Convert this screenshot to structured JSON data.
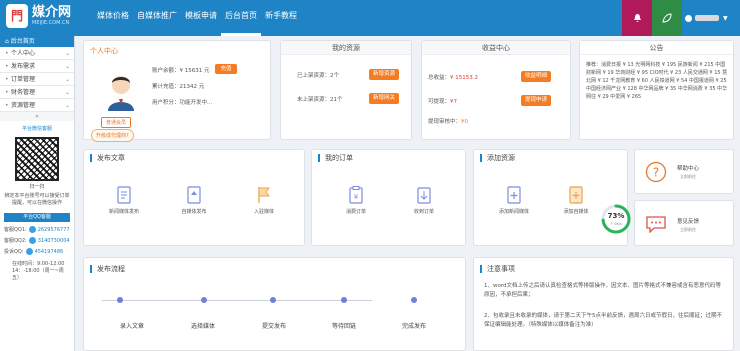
{
  "topbar": {
    "logo_mark": "門",
    "logo_title": "媒介网",
    "logo_sub": "MEIJIE.COM.CN",
    "nav": [
      "媒体价格",
      "自媒体推广",
      "模板申请",
      "后台首页",
      "新手教程"
    ],
    "active_nav": 3,
    "colors": {
      "bar": "#1e84c6",
      "bell": "#b0195a",
      "home": "#2f8c44"
    }
  },
  "sidebar": {
    "header": "后台首页",
    "items": [
      {
        "label": "个人中心",
        "icon": "user-icon"
      },
      {
        "label": "发布需求",
        "icon": "send-icon"
      },
      {
        "label": "订单管理",
        "icon": "order-icon"
      },
      {
        "label": "财务管理",
        "icon": "finance-icon"
      },
      {
        "label": "资源管理",
        "icon": "resource-icon"
      }
    ],
    "wechat_title": "平台微信客服",
    "qr_caption": "扫一扫",
    "qr_desc": "绑定本平台账号可以接受订单提醒，可以在微信操作",
    "qq_title": "平台QQ客服",
    "qq": [
      {
        "label": "客服QQ1:",
        "number": "2629576777"
      },
      {
        "label": "客服QQ2:",
        "number": "3140730004"
      },
      {
        "label": "投诉QQ:",
        "number": "454197486"
      }
    ],
    "hours_1": "在线时间：9:00-12:00",
    "hours_2": "14：-18:00（周一~周五）"
  },
  "personal": {
    "title": "个人中心",
    "login_tag": "普通会员",
    "upgrade": "升级成代理商?",
    "balance_label": "账户余额：",
    "balance_value": "¥ 15631 元",
    "recharge": "充值",
    "spent_label": "累计充值：",
    "spent_value": "21342 元",
    "points_label": "用户积分：",
    "points_value": "功能开发中..."
  },
  "resources": {
    "title": "我的资源",
    "online_label": "已上架资源：",
    "online_count": "2个",
    "offline_label": "未上架资源：",
    "offline_count": "21个",
    "btn_new": "新增资源",
    "btn_all": "新增网关"
  },
  "income": {
    "title": "收益中心",
    "total_label": "总收益：",
    "total_value": "¥ 15153.2",
    "withdrawable_label": "可提现：",
    "withdrawable_value": "¥7",
    "pending_label": "提现审核中：",
    "pending_value": "¥0",
    "btn_detail": "收益明细",
    "btn_withdraw": "提现申请"
  },
  "notice": {
    "title": "公告",
    "text": "推荐：消费日报 ¥ 13 光明网科技 ¥ 195 民族新闻 ¥ 215 中国财新网 ¥ 19 华商财经 ¥ 95 CIO时代 ¥ 23 人民交通网 ¥ 15 慧北网 ¥ 12 千龙网教育 ¥ 60 人民铁道网 ¥ 54 中国报道网 ¥ 25 中国经济网产业 ¥ 128 中华网品牌 ¥ 35 中华网消费 ¥ 35 中华网往 ¥ 29 中爱网 ¥ 265"
  },
  "publish": {
    "title": "发布文章",
    "tools": [
      {
        "label": "新闻媒体发布",
        "icon": "news-media-icon"
      },
      {
        "label": "自媒体发布",
        "icon": "self-media-icon"
      },
      {
        "label": "入驻媒体",
        "icon": "flag-icon"
      }
    ]
  },
  "orders": {
    "title": "我的订单",
    "tools": [
      {
        "label": "消费订单",
        "icon": "clipboard-icon"
      },
      {
        "label": "收到订单",
        "icon": "inbox-icon"
      }
    ]
  },
  "add_resource": {
    "title": "添加资源",
    "tools": [
      {
        "label": "添加新闻媒体",
        "icon": "doc-plus-icon"
      },
      {
        "label": "添加自媒体",
        "icon": "doc-plus-orange-icon"
      }
    ],
    "meter_value": "73%",
    "meter_fraction": 0.73,
    "meter_sub": "↑ 0K/s"
  },
  "help": {
    "label": "帮助中心",
    "sub": "立即前往"
  },
  "feedback": {
    "label": "意见反馈",
    "sub": "立即前往"
  },
  "flow": {
    "title": "发布流程",
    "steps": [
      "录入文章",
      "选择媒体",
      "提交发布",
      "等待回链",
      "完成发布"
    ]
  },
  "notes": {
    "title": "注意事项",
    "items": [
      "1、word文档上传之后请认真检查格式等排版操作，因文本、图片等格式不兼容或含有恶意代码等原因，不承担后果；",
      "2、包收录且未收录的媒体，请于第二天下午5点半前反馈，遇周六日或节假日，往后顺延；过期不保证编辑能处理。（特殊媒体以媒体备注为准）"
    ]
  }
}
